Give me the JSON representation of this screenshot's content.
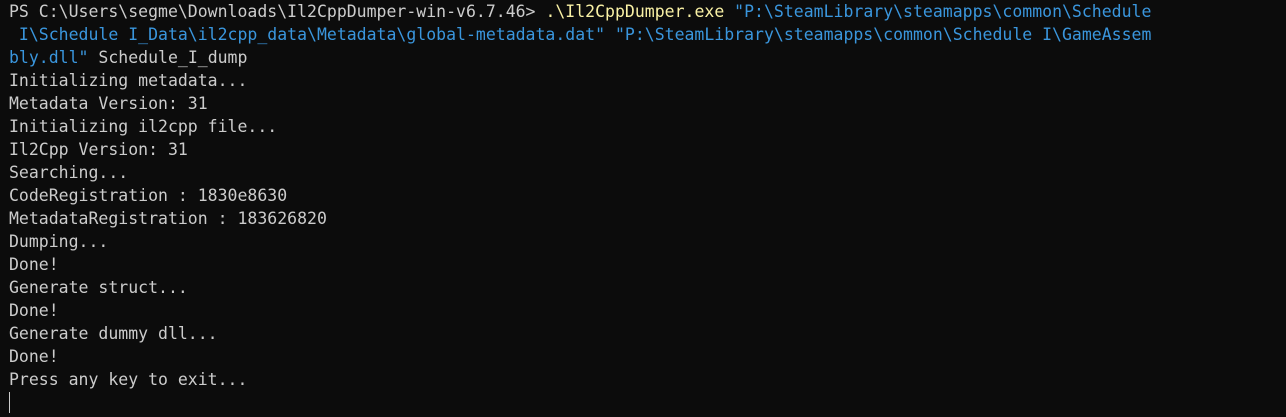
{
  "terminal": {
    "colors": {
      "background": "#0c0c0c",
      "foreground": "#cccccc",
      "command": "#f9f1a5",
      "string": "#3a96dd"
    },
    "command": {
      "prompt": "PS C:\\Users\\segme\\Downloads\\Il2CppDumper-win-v6.7.46> ",
      "exe": ".\\Il2CppDumper.exe",
      "arg1_part1": " \"P:\\SteamLibrary\\steamapps\\common\\Schedule",
      "arg1_part2": " I\\Schedule I_Data\\il2cpp_data\\Metadata\\global-metadata.dat\"",
      "arg2_part1": " \"P:\\SteamLibrary\\steamapps\\common\\Schedule I\\GameAssem",
      "arg2_part2": "bly.dll\"",
      "arg3": " Schedule_I_dump"
    },
    "output": [
      "Initializing metadata...",
      "Metadata Version: 31",
      "Initializing il2cpp file...",
      "Il2Cpp Version: 31",
      "Searching...",
      "CodeRegistration : 1830e8630",
      "MetadataRegistration : 183626820",
      "Dumping...",
      "Done!",
      "Generate struct...",
      "Done!",
      "Generate dummy dll...",
      "Done!",
      "Press any key to exit..."
    ]
  }
}
